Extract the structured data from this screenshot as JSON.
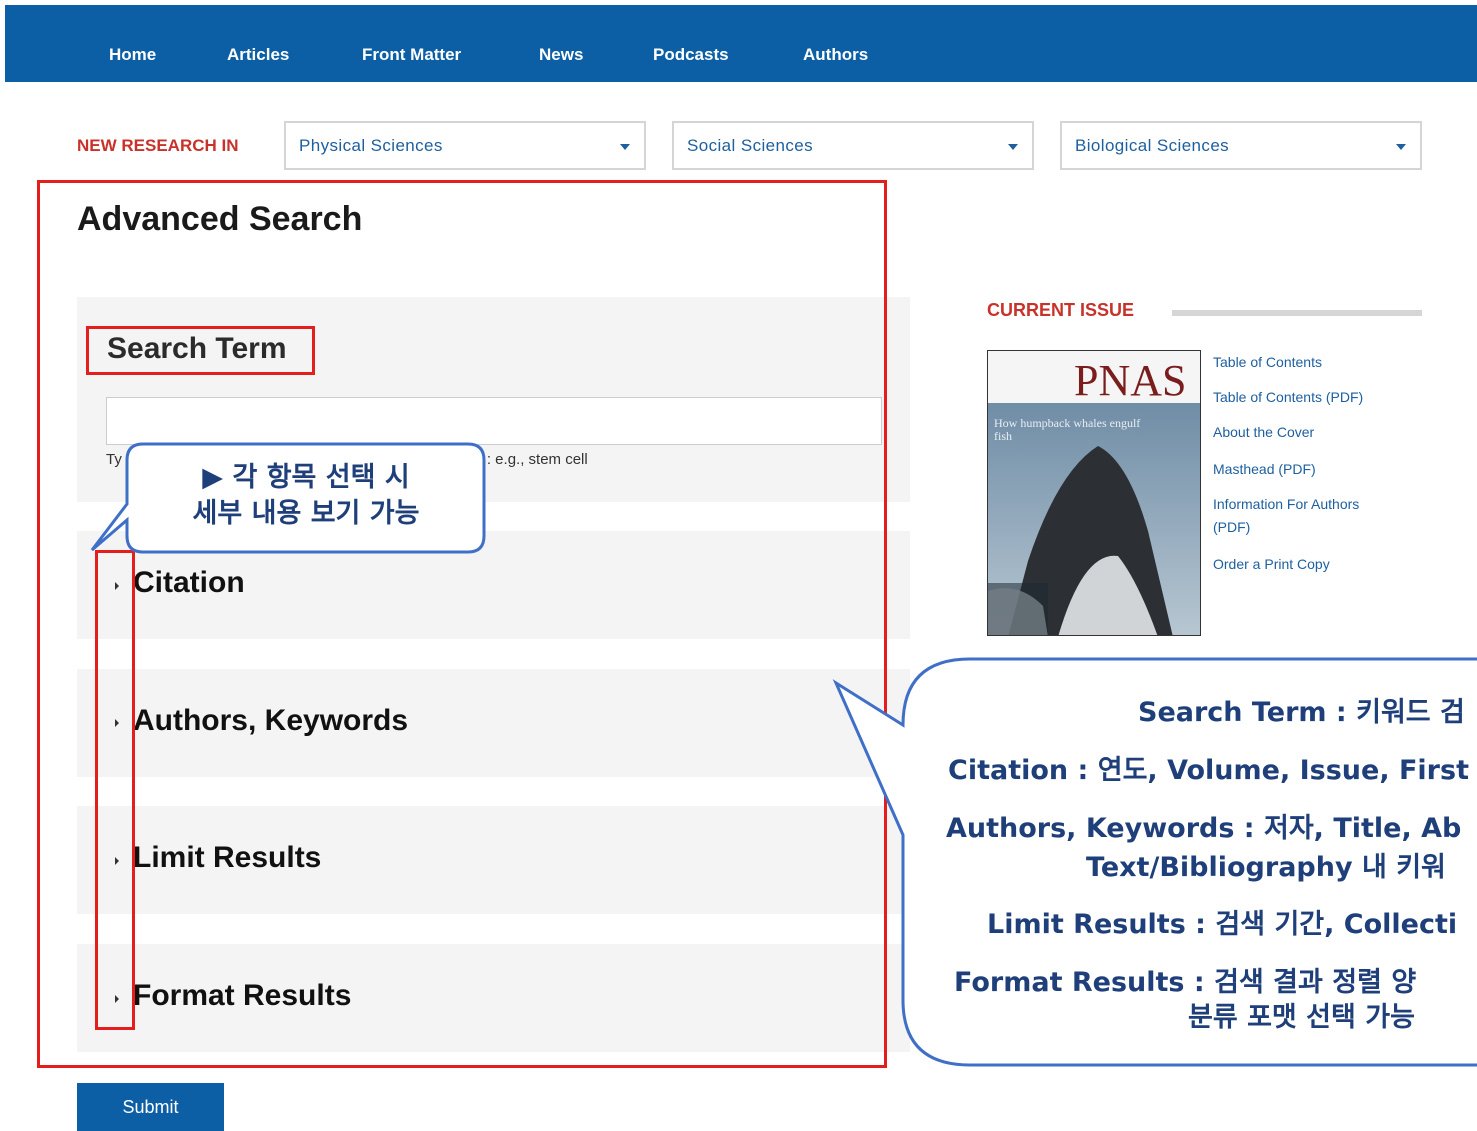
{
  "nav": {
    "items": [
      "Home",
      "Articles",
      "Front Matter",
      "News",
      "Podcasts",
      "Authors"
    ]
  },
  "research": {
    "label": "NEW RESEARCH IN",
    "selects": [
      "Physical Sciences",
      "Social Sciences",
      "Biological Sciences"
    ]
  },
  "search": {
    "title": "Advanced Search",
    "term_label": "Search Term",
    "hint_prefix": "Ty",
    "hint_suffix": ": e.g., stem cell",
    "sections": [
      "Citation",
      "Authors, Keywords",
      "Limit Results",
      "Format Results"
    ],
    "submit": "Submit"
  },
  "current_issue": {
    "heading": "CURRENT ISSUE",
    "cover_title": "PNAS",
    "cover_caption": "How humpback whales engulf fish",
    "links": [
      "Table of Contents",
      "Table of Contents (PDF)",
      "About the Cover",
      "Masthead (PDF)",
      "Information For Authors",
      "(PDF)",
      "Order a Print Copy"
    ]
  },
  "callouts": {
    "small_line1": "▶ 각 항목 선택 시",
    "small_line2": "세부 내용 보기 가능",
    "big_lines": [
      "Search Term : 키워드 검",
      "Citation : 연도, Volume, Issue, First",
      "Authors, Keywords : 저자, Title, Ab",
      "Text/Bibliography 내 키워",
      "Limit Results : 검색 기간, Collecti",
      "Format Results : 검색 결과 정렬 양",
      "분류 포맷 선택 가능"
    ]
  },
  "colors": {
    "nav_bg": "#0d5fa5",
    "accent_red": "#c8322a",
    "link_blue": "#1d5f9f",
    "highlight_red": "#e41d1d",
    "callout_border": "#3f6fc7"
  }
}
